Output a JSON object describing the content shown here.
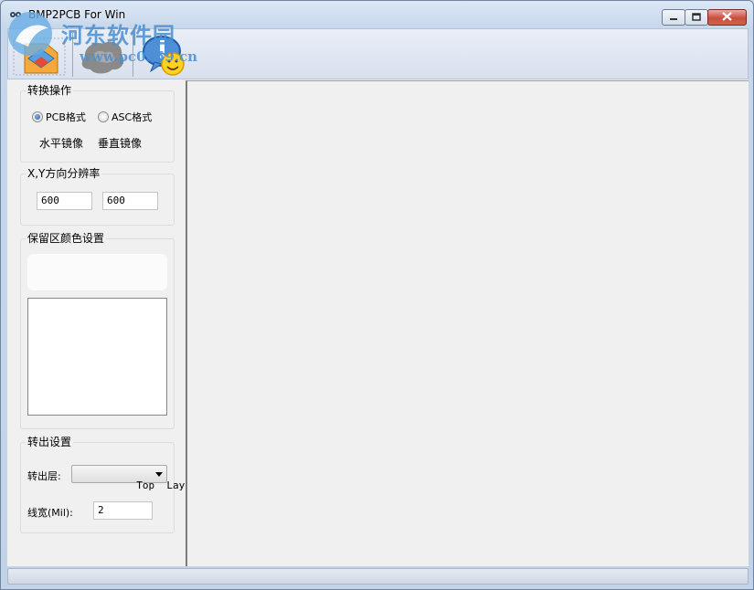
{
  "window": {
    "title": "BMP2PCB For Win",
    "buttons": {
      "minimize": "minimize",
      "maximize": "maximize",
      "close": "close"
    }
  },
  "watermark": {
    "line1": "河东软件园",
    "line2": "www.pc0359.cn"
  },
  "toolbar": {
    "buttons": [
      {
        "icon": "open-image-icon"
      },
      {
        "icon": "convert-icon"
      },
      {
        "icon": "about-icon"
      }
    ]
  },
  "convert_group": {
    "legend": "转换操作",
    "radio_pcb": "PCB格式",
    "radio_asc": "ASC格式",
    "selected": "PCB格式",
    "mirror_h": "水平镜像",
    "mirror_v": "垂直镜像"
  },
  "resolution_group": {
    "legend": "X,Y方向分辨率",
    "x_value": "600",
    "y_value": "600"
  },
  "color_group": {
    "legend": "保留区颜色设置"
  },
  "output_group": {
    "legend": "转出设置",
    "layer_label": "转出层:",
    "layer_value": "Top  Layer",
    "width_label": "线宽(Mil):",
    "width_value": "2"
  },
  "colors": {
    "titlebar": "#cbd9ea",
    "client": "#f0f0f0",
    "close_button": "#c94f3e",
    "watermark": "#4a8fd0"
  }
}
